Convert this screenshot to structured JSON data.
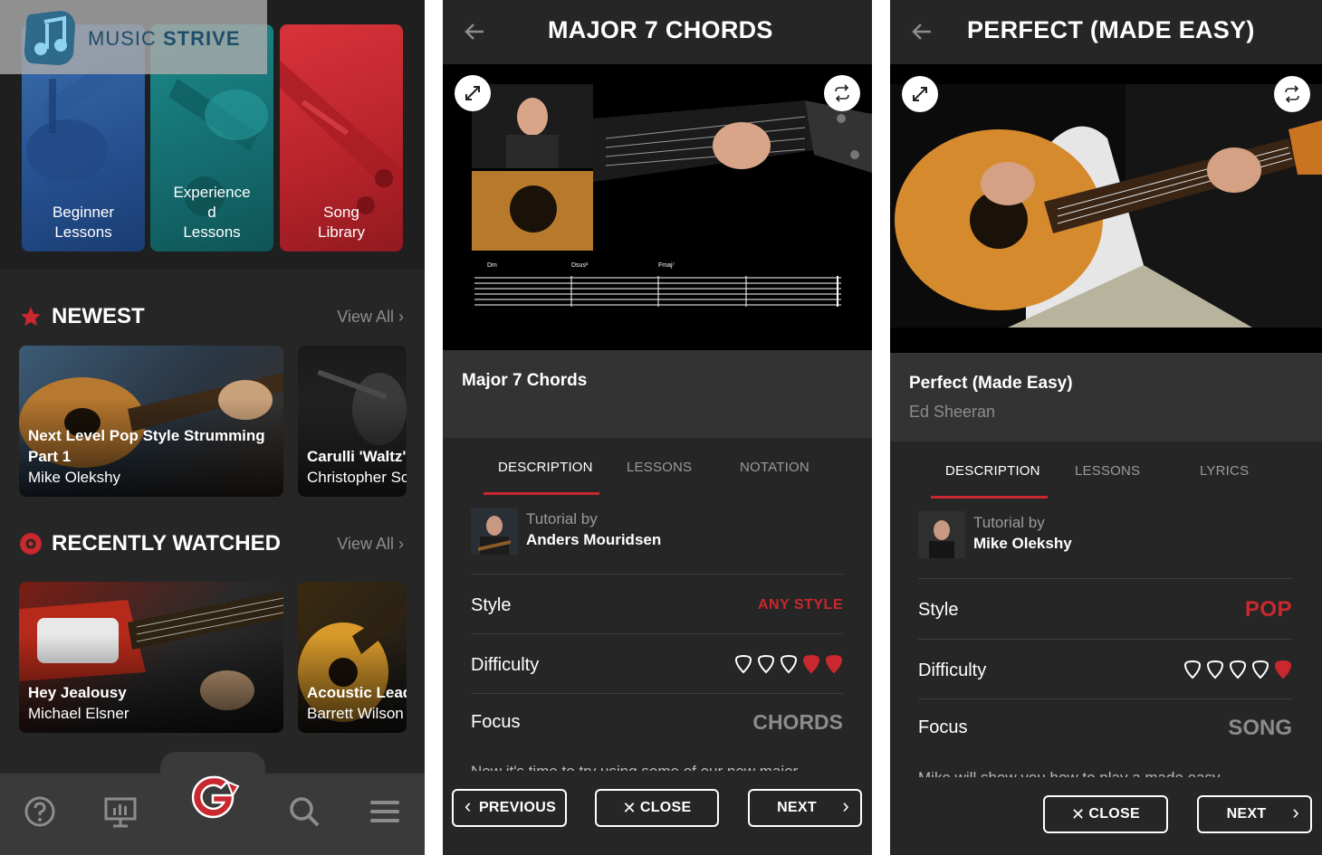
{
  "home": {
    "logo": {
      "text_light": "MUSIC ",
      "text_bold": "STRIVE"
    },
    "categories": [
      {
        "label": "Beginner\nLessons"
      },
      {
        "label": "Experience\nd\nLessons"
      },
      {
        "label": "Song\nLibrary"
      }
    ],
    "newest": {
      "title": "NEWEST",
      "view_all": "View All",
      "cards": [
        {
          "title": "Next Level Pop Style Strumming Part 1",
          "author": "Mike Olekshy"
        },
        {
          "title": "Carulli 'Waltz'",
          "author": "Christopher Sc"
        }
      ]
    },
    "recent": {
      "title": "RECENTLY WATCHED",
      "view_all": "View All",
      "cards": [
        {
          "title": "Hey Jealousy",
          "author": "Michael Elsner"
        },
        {
          "title": "Acoustic Lead",
          "author": "Barrett Wilson"
        }
      ]
    },
    "nav": [
      {
        "icon": "help-icon"
      },
      {
        "icon": "chart-board-icon"
      },
      {
        "icon": "g-logo-icon"
      },
      {
        "icon": "search-icon"
      },
      {
        "icon": "menu-icon"
      }
    ]
  },
  "lesson1": {
    "page_title": "MAJOR 7 CHORDS",
    "title": "Major 7 Chords",
    "tab_chords": [
      "Dm",
      "Dsus²",
      "Fmaj⁷"
    ],
    "tabs": [
      "DESCRIPTION",
      "LESSONS",
      "NOTATION"
    ],
    "tutor_prefix": "Tutorial by",
    "tutor": "Anders Mouridsen",
    "style_label": "Style",
    "style_value": "ANY STYLE",
    "difficulty_label": "Difficulty",
    "difficulty_level": 2,
    "difficulty_max": 5,
    "focus_label": "Focus",
    "focus_value": "CHORDS",
    "desc_peek": "Now it's time to try using some of our new major",
    "btn_prev": "PREVIOUS",
    "btn_close": "CLOSE",
    "btn_next": "NEXT"
  },
  "lesson2": {
    "page_title": "PERFECT (MADE EASY)",
    "title": "Perfect (Made Easy)",
    "artist": "Ed Sheeran",
    "tabs": [
      "DESCRIPTION",
      "LESSONS",
      "LYRICS"
    ],
    "tutor_prefix": "Tutorial by",
    "tutor": "Mike Olekshy",
    "style_label": "Style",
    "style_value": "POP",
    "difficulty_label": "Difficulty",
    "difficulty_level": 1,
    "difficulty_max": 5,
    "focus_label": "Focus",
    "focus_value": "SONG",
    "desc_peek": "Mike will show you how to play a made easy",
    "btn_close": "CLOSE",
    "btn_next": "NEXT"
  },
  "colors": {
    "accent": "#c8282e",
    "bg": "#262626",
    "panel": "#333333",
    "muted": "#8c8c8c"
  }
}
